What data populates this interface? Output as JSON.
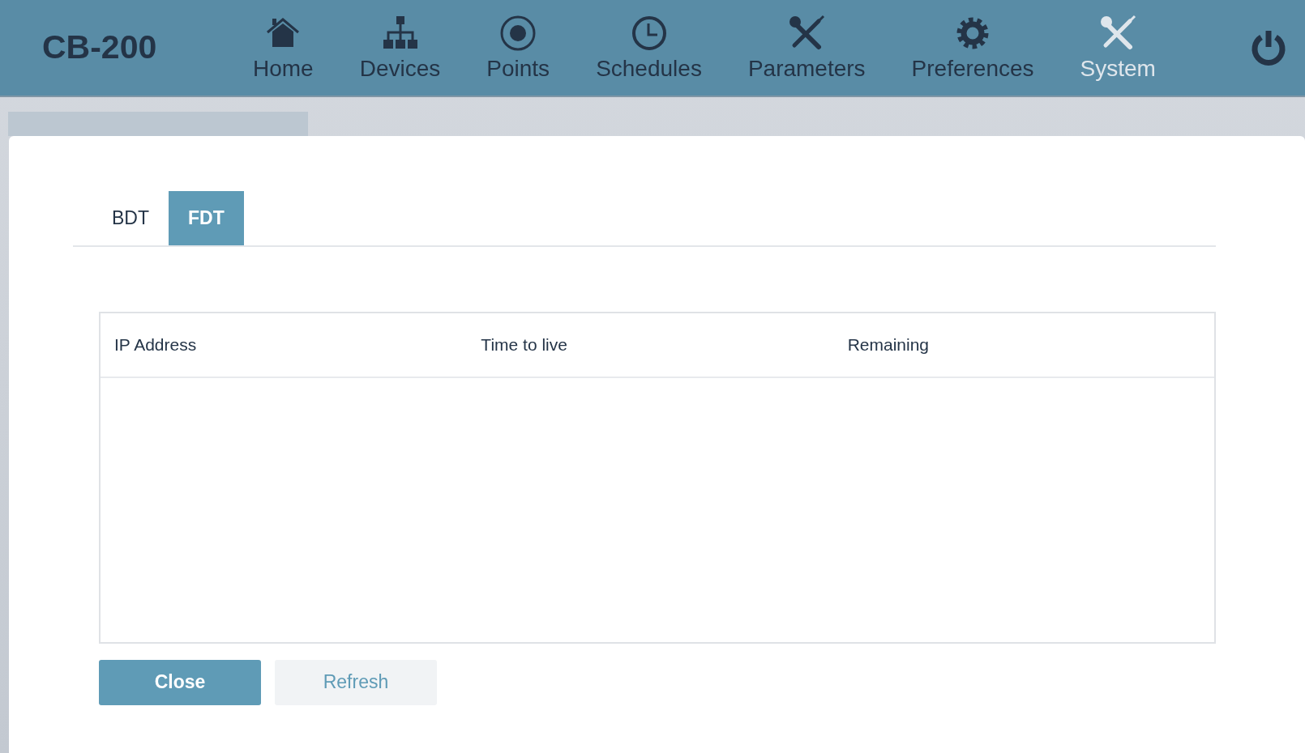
{
  "brand": "CB-200",
  "nav": [
    {
      "label": "Home",
      "kind": "home",
      "selected": false
    },
    {
      "label": "Devices",
      "kind": "devices",
      "selected": false
    },
    {
      "label": "Points",
      "kind": "points",
      "selected": false
    },
    {
      "label": "Schedules",
      "kind": "clock",
      "selected": false
    },
    {
      "label": "Parameters",
      "kind": "tools",
      "selected": false
    },
    {
      "label": "Preferences",
      "kind": "gear",
      "selected": false
    },
    {
      "label": "System",
      "kind": "tools",
      "selected": true
    }
  ],
  "tabs": [
    {
      "label": "BDT",
      "selected": false
    },
    {
      "label": "FDT",
      "selected": true
    }
  ],
  "table": {
    "columns": [
      "IP Address",
      "Time to live",
      "Remaining"
    ]
  },
  "buttons": [
    {
      "label": "Close",
      "kind": "primary"
    },
    {
      "label": "Refresh",
      "kind": "secondary"
    }
  ]
}
